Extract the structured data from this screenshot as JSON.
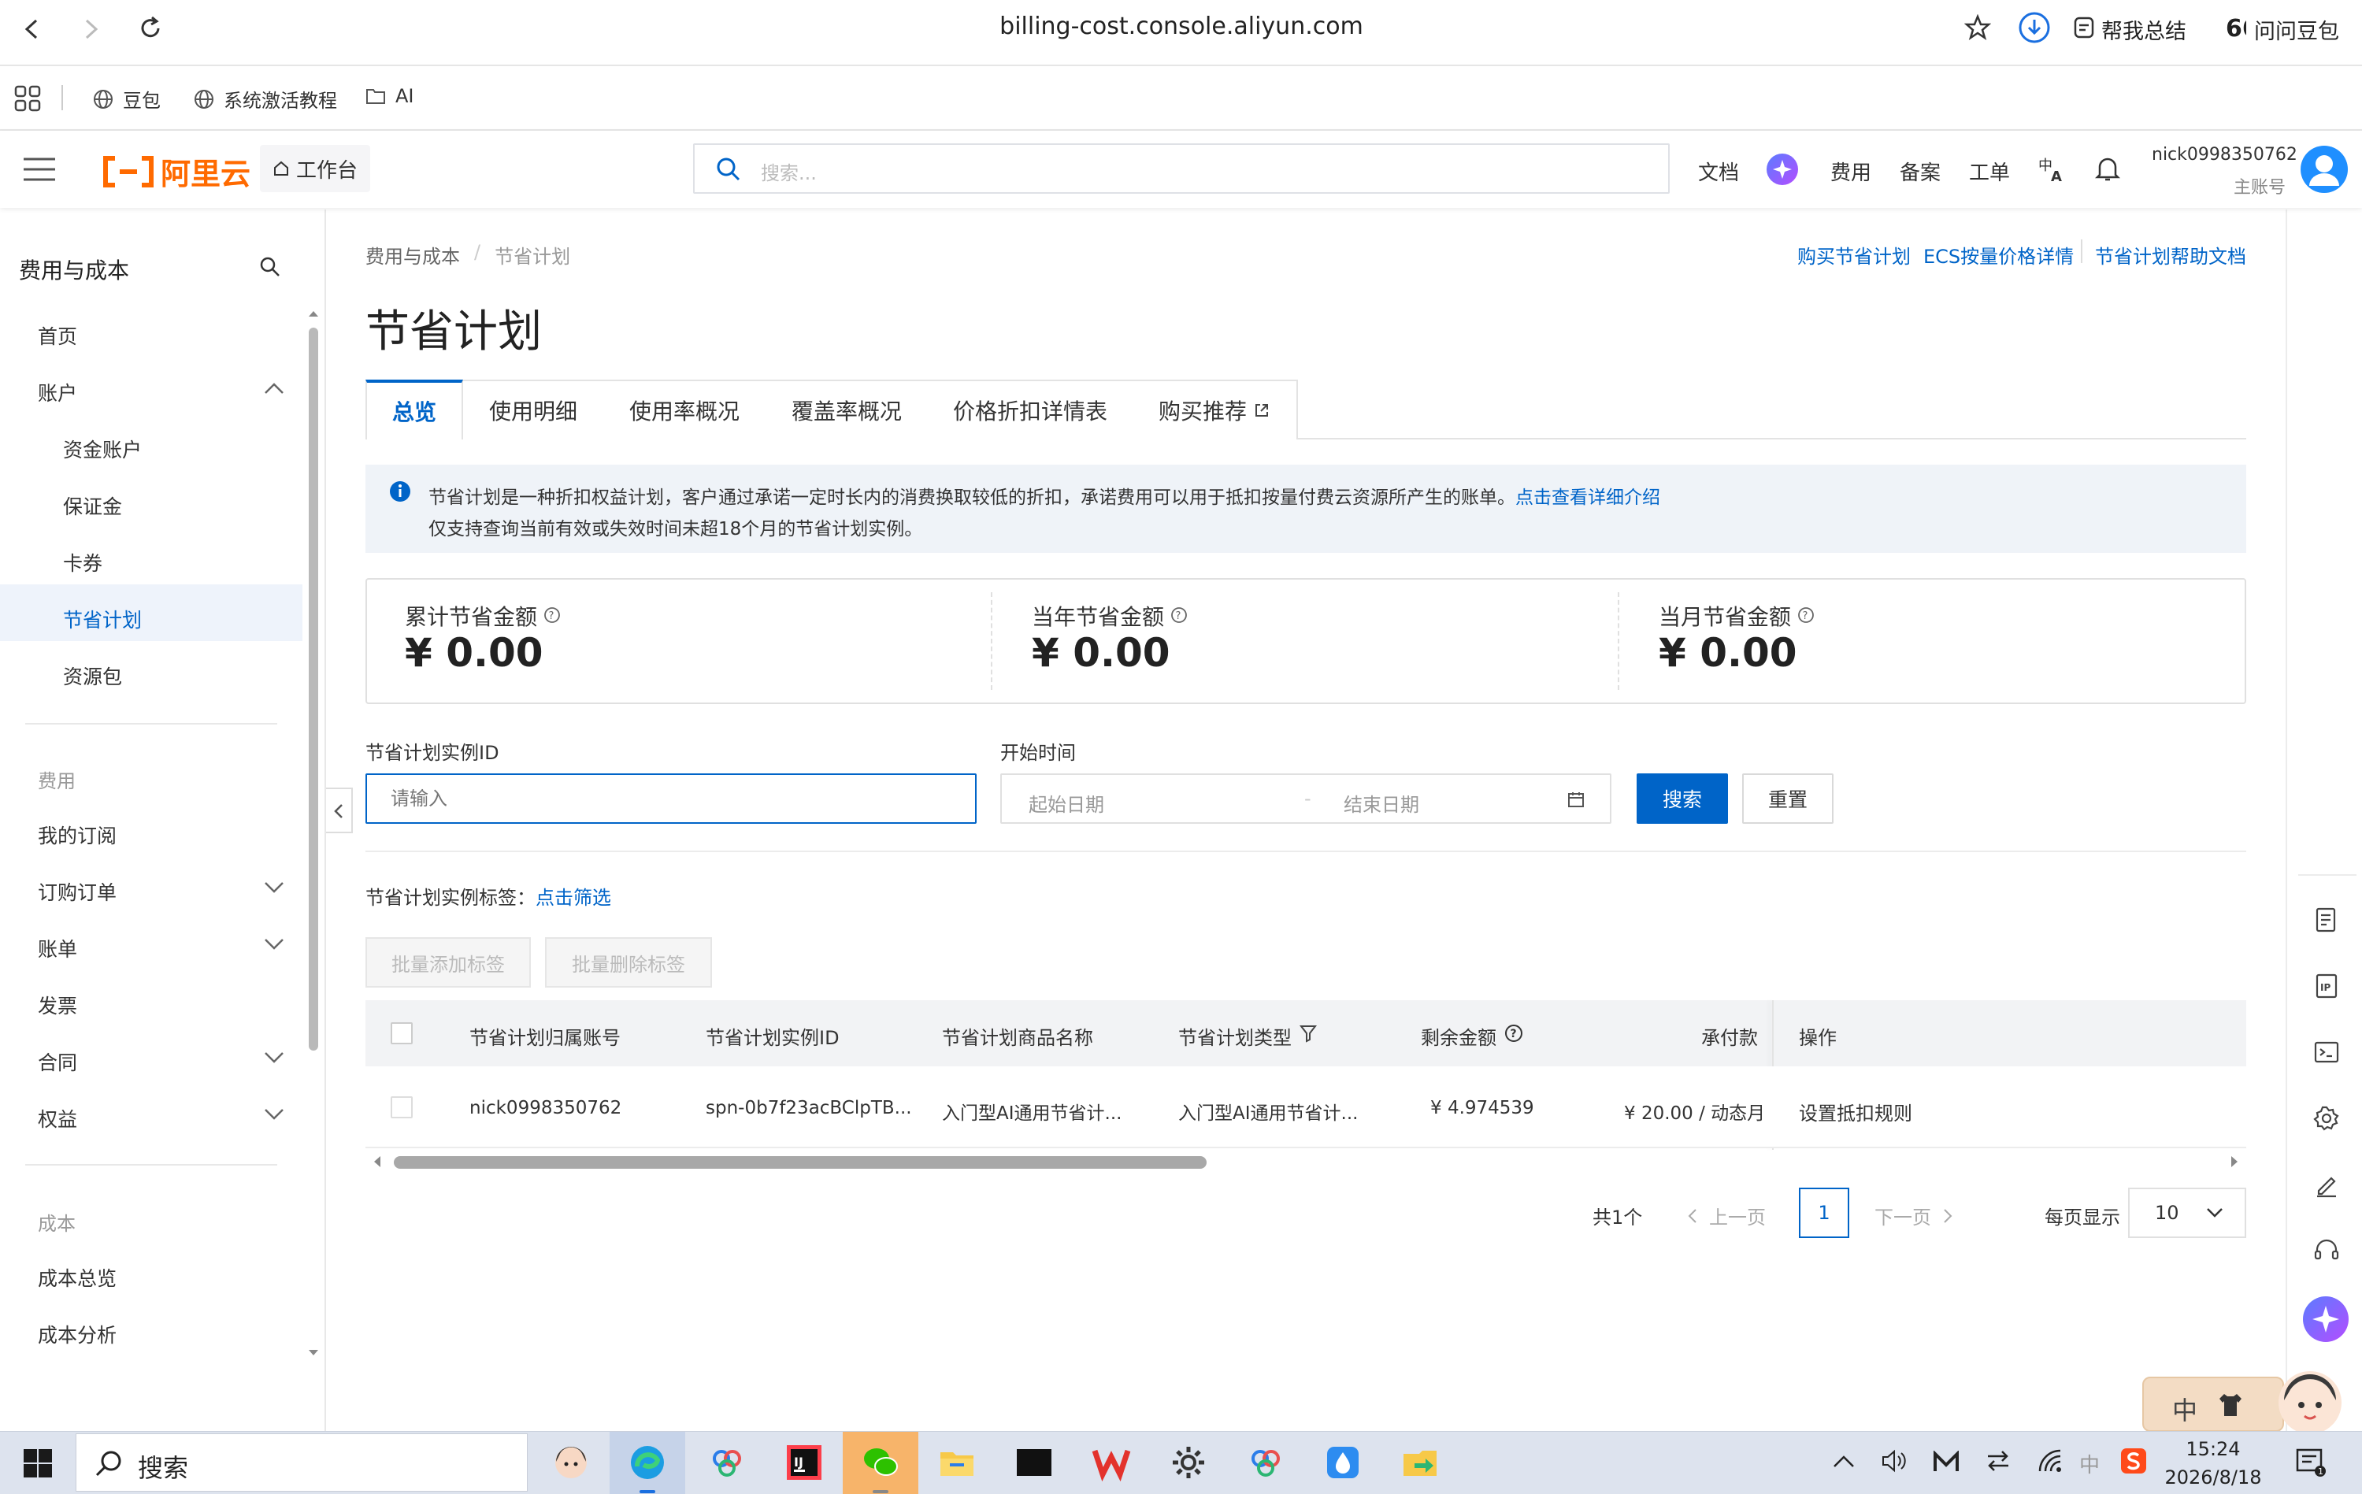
{
  "browser": {
    "url": "billing-cost.console.aliyun.com",
    "summary_label": "帮我总结",
    "ask_label": "问问豆包"
  },
  "bookmarks": [
    "豆包",
    "系统激活教程",
    "AI"
  ],
  "header": {
    "logo_text": "阿里云",
    "workbench": "工作台",
    "search_placeholder": "搜索...",
    "links": [
      "文档",
      "费用",
      "备案",
      "工单"
    ],
    "username": "nick0998350762",
    "account_type": "主账号"
  },
  "sidebar": {
    "title": "费用与成本",
    "items": {
      "home": "首页",
      "account": "账户",
      "fund_account": "资金账户",
      "deposit": "保证金",
      "coupons": "卡券",
      "savings_plan": "节省计划",
      "resource_pack": "资源包",
      "group_fee": "费用",
      "my_subs": "我的订阅",
      "orders": "订购订单",
      "bills": "账单",
      "invoice": "发票",
      "contract": "合同",
      "rights": "权益",
      "group_cost": "成本",
      "cost_overview": "成本总览",
      "cost_analysis": "成本分析"
    }
  },
  "main": {
    "breadcrumb": [
      "费用与成本",
      "节省计划"
    ],
    "top_links": [
      "购买节省计划",
      "ECS按量价格详情",
      "节省计划帮助文档"
    ],
    "title": "节省计划",
    "tabs": [
      "总览",
      "使用明细",
      "使用率概况",
      "覆盖率概况",
      "价格折扣详情表",
      "购买推荐"
    ],
    "notice_line1": "节省计划是一种折扣权益计划，客户通过承诺一定时长内的消费换取较低的折扣，承诺费用可以用于抵扣按量付费云资源所产生的账单。",
    "notice_link": "点击查看详细介绍",
    "notice_line2": "仅支持查询当前有效或失效时间未超18个月的节省计划实例。",
    "stats": [
      {
        "label": "累计节省金额",
        "value": "¥ 0.00"
      },
      {
        "label": "当年节省金额",
        "value": "¥ 0.00"
      },
      {
        "label": "当月节省金额",
        "value": "¥ 0.00"
      }
    ],
    "filter": {
      "id_label": "节省计划实例ID",
      "id_placeholder": "请输入",
      "time_label": "开始时间",
      "start_placeholder": "起始日期",
      "end_placeholder": "结束日期",
      "search": "搜索",
      "reset": "重置"
    },
    "tag_label": "节省计划实例标签：",
    "tag_link": "点击筛选",
    "batch_add": "批量添加标签",
    "batch_remove": "批量删除标签",
    "table": {
      "headers": [
        "节省计划归属账号",
        "节省计划实例ID",
        "节省计划商品名称",
        "节省计划类型",
        "剩余金额",
        "承付款",
        "操作"
      ],
      "rows": [
        [
          "nick0998350762",
          "spn-0b7f23acBClpTB...",
          "入门型AI通用节省计...",
          "入门型AI通用节省计...",
          "¥ 4.974539",
          "¥ 20.00 / 动态月",
          "设置抵扣规则"
        ]
      ]
    },
    "pagination": {
      "total": "共1个",
      "prev": "上一页",
      "page": "1",
      "next": "下一页",
      "per_page_label": "每页显示",
      "per_page": "10"
    }
  },
  "ime": {
    "mode": "中"
  },
  "taskbar": {
    "search": "搜索",
    "time": "15:24",
    "date": "2026/8/18",
    "tray_ime": "中"
  }
}
